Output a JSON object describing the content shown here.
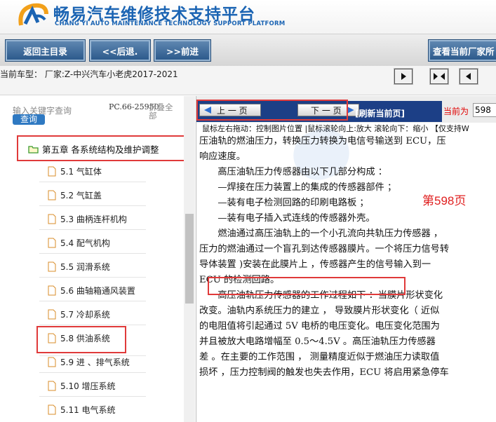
{
  "header": {
    "title": "畅易汽车维修技术支持平台",
    "subtitle": "CHANG YI AUTO MAINTENANCE TECHNOLOGY SUPPORT PLATFORM"
  },
  "toolbar": {
    "home": "返回主目录",
    "back": "<<后退.",
    "forward": ">>前进",
    "view_factory": "查看当前厂家所"
  },
  "infobar": {
    "model": "当前车型： 厂家:Z-中兴汽车小老虎2017-2021"
  },
  "left": {
    "search_hint": "输入关键字查询",
    "search_button": "查询",
    "pc_code": "PC.66-25950",
    "collapse_all": "折叠全部",
    "chapter": "第五章 各系统结构及维护调整",
    "items": [
      {
        "label": "5.1 气缸体"
      },
      {
        "label": "5.2 气缸盖"
      },
      {
        "label": "5.3 曲柄连杆机构"
      },
      {
        "label": "5.4 配气机构"
      },
      {
        "label": "5.5 润滑系统"
      },
      {
        "label": "5.6 曲轴箱通风装置"
      },
      {
        "label": "5.7 冷却系统"
      },
      {
        "label": "5.8 供油系统"
      },
      {
        "label": "5.9 进 、排气系统"
      },
      {
        "label": "5.10 增压系统"
      },
      {
        "label": "5.11 电气系统"
      }
    ]
  },
  "right": {
    "prev_page": "上 一 页",
    "next_page": "下 一 页",
    "refresh": "[刷新当前页]",
    "current_label": "当前为",
    "current_page": "598",
    "hint": "鼠标左右拖动：控制图片位置 |鼠标滚轮向上:放大  滚轮向下：缩小 【仅支持W",
    "page_overlay": "第598页",
    "doc_lines": [
      "压油轨的燃油压力，转换压力转换为电信号输送到 ECU，压",
      "响应速度。",
      "　　高压油轨压力传感器由以下几部分构成 ：",
      "　　—焊接在压力装置上的集成的传感器部件 ；",
      "　　—装有电子检测回路的印刷电路板 ；",
      "　　—装有电子插入式连线的传感器外壳。",
      "　　燃油通过高压油轨上的一个小孔流向共轨压力传感器 ，",
      "压力的燃油通过一个盲孔到达传感器膜片。一个将压力信号转",
      "导体装置 )安装在此膜片上 ，传感器产生的信号输入到一",
      "ECU 的检测回路。",
      "　　高压油轨压力传感器的工作过程如下 ：当膜片形状变化",
      "改变。油轨内系统压力的建立 ， 导致膜片形状变化（ 近似",
      "的电阻值将引起通过 5V 电桥的电压变化。电压变化范围为",
      "并且被放大电路增幅至 0.5～4.5V 。高压油轨压力传感器",
      "差 。在主要的工作范围 ， 测量精度近似于燃油压力读取值",
      "损坏 ，压力控制阀的触发也失去作用，ECU 将启用紧急停车"
    ]
  },
  "colors": {
    "brand_blue": "#1b64b3",
    "nav_blue": "#1c3f86",
    "highlight_red": "#e03a3a"
  }
}
